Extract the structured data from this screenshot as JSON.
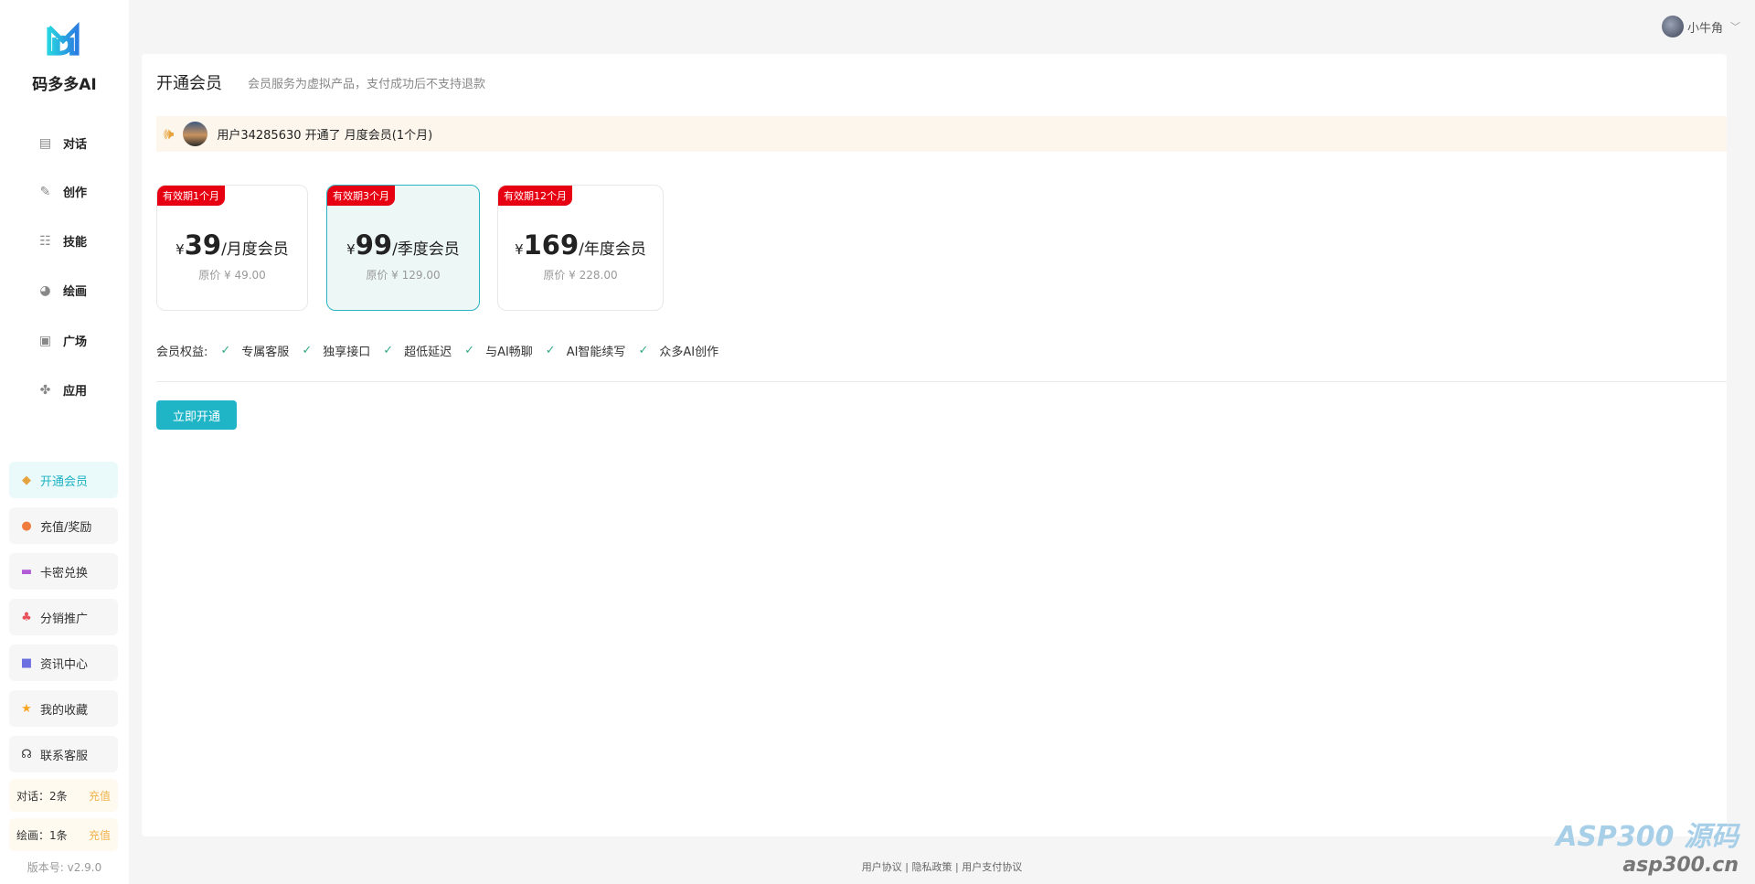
{
  "brand": {
    "name": "码多多AI"
  },
  "nav": [
    {
      "label": "对话",
      "icon": "chat-icon"
    },
    {
      "label": "创作",
      "icon": "pen-icon"
    },
    {
      "label": "技能",
      "icon": "list-icon"
    },
    {
      "label": "绘画",
      "icon": "palette-icon"
    },
    {
      "label": "广场",
      "icon": "image-icon"
    },
    {
      "label": "应用",
      "icon": "apps-icon"
    }
  ],
  "side_buttons": [
    {
      "label": "开通会员",
      "icon": "diamond-icon",
      "color": "#e6a23c"
    },
    {
      "label": "充值/奖励",
      "icon": "recharge-icon",
      "color": "#f07b3f"
    },
    {
      "label": "卡密兑换",
      "icon": "card-icon",
      "color": "#b15bd6"
    },
    {
      "label": "分销推广",
      "icon": "network-icon",
      "color": "#e8505b"
    },
    {
      "label": "资讯中心",
      "icon": "news-icon",
      "color": "#6c6fe0"
    },
    {
      "label": "我的收藏",
      "icon": "star-icon",
      "color": "#f5a623"
    },
    {
      "label": "联系客服",
      "icon": "headset-icon",
      "color": "#333333"
    }
  ],
  "quota": [
    {
      "label": "对话：2条",
      "action": "充值"
    },
    {
      "label": "绘画：1条",
      "action": "充值"
    }
  ],
  "version": "版本号: v2.9.0",
  "user": {
    "name": "小牛角"
  },
  "page": {
    "title": "开通会员",
    "subtitle": "会员服务为虚拟产品，支付成功后不支持退款"
  },
  "notice": {
    "text": "用户34285630 开通了 月度会员(1个月)"
  },
  "plans": [
    {
      "tag": "有效期1个月",
      "currency": "¥",
      "price": "39",
      "unit": "/月度会员",
      "original": "原价 ¥ 49.00",
      "selected": false
    },
    {
      "tag": "有效期3个月",
      "currency": "¥",
      "price": "99",
      "unit": "/季度会员",
      "original": "原价 ¥ 129.00",
      "selected": true
    },
    {
      "tag": "有效期12个月",
      "currency": "¥",
      "price": "169",
      "unit": "/年度会员",
      "original": "原价 ¥ 228.00",
      "selected": false
    }
  ],
  "benefits": {
    "label": "会员权益:",
    "items": [
      "专属客服",
      "独享接口",
      "超低延迟",
      "与AI畅聊",
      "AI智能续写",
      "众多AI创作"
    ]
  },
  "buy_label": "立即开通",
  "footer": {
    "links": [
      "用户协议",
      "隐私政策",
      "用户支付协议"
    ],
    "sep": "|"
  },
  "watermark": {
    "line1": "ASP300 源码",
    "line2": "asp300.cn"
  }
}
